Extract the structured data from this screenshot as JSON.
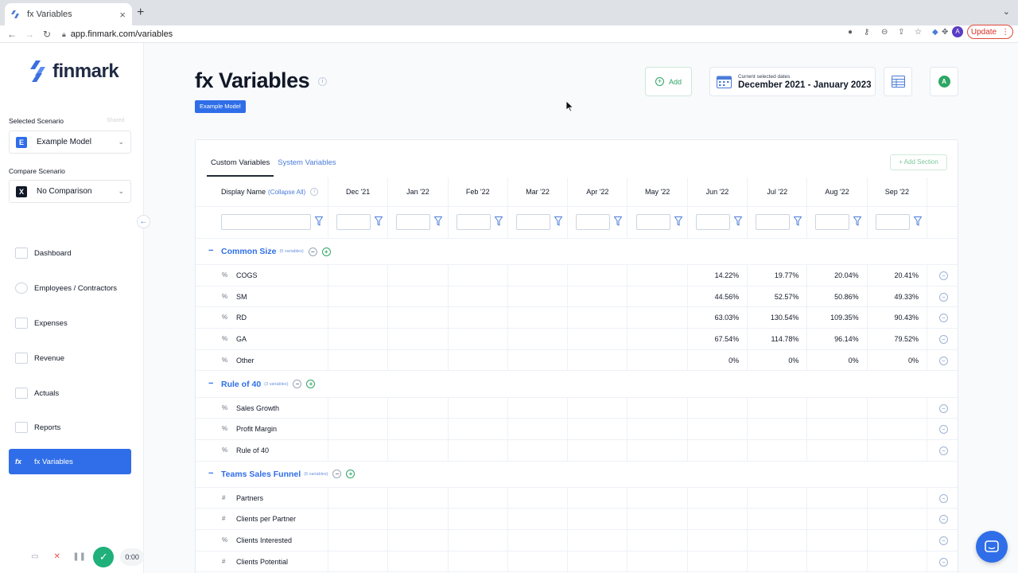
{
  "browser": {
    "tab_title": "fx Variables",
    "url": "app.finmark.com/variables",
    "new_tab": "+",
    "update_label": "Update",
    "profile_initial": "A"
  },
  "sidebar": {
    "brand": "finmark",
    "selected_scenario_label": "Selected Scenario",
    "shared_label": "Shared",
    "selected_scenario": {
      "chip": "E",
      "name": "Example Model"
    },
    "compare_scenario_label": "Compare Scenario",
    "compare_scenario": {
      "chip": "X",
      "name": "No Comparison"
    },
    "nav": [
      {
        "label": "Dashboard"
      },
      {
        "label": "Employees / Contractors"
      },
      {
        "label": "Expenses"
      },
      {
        "label": "Revenue"
      },
      {
        "label": "Actuals"
      },
      {
        "label": "Reports"
      },
      {
        "label": "fx Variables",
        "icon_text": "fx"
      }
    ],
    "recorder_time": "0:00"
  },
  "header": {
    "title": "fx Variables",
    "model_badge": "Example Model",
    "add_label": "Add",
    "dates_caption": "Current selected dates",
    "dates_value": "December 2021 - January 2023",
    "user_initial": "A"
  },
  "table": {
    "tabs": [
      "Custom Variables",
      "System Variables"
    ],
    "add_section_label": "+ Add Section",
    "name_header": "Display Name",
    "collapse_all": "(Collapse All)",
    "months": [
      "Dec '21",
      "Jan '22",
      "Feb '22",
      "Mar '22",
      "Apr '22",
      "May '22",
      "Jun '22",
      "Jul '22",
      "Aug '22",
      "Sep '22"
    ],
    "sections": [
      {
        "name": "Common Size",
        "count": "(5 variables)",
        "rows": [
          {
            "sym": "%",
            "name": "COGS",
            "values": [
              "",
              "",
              "",
              "",
              "",
              "",
              "14.22%",
              "19.77%",
              "20.04%",
              "20.41%"
            ]
          },
          {
            "sym": "%",
            "name": "SM",
            "values": [
              "",
              "",
              "",
              "",
              "",
              "",
              "44.56%",
              "52.57%",
              "50.86%",
              "49.33%"
            ]
          },
          {
            "sym": "%",
            "name": "RD",
            "values": [
              "",
              "",
              "",
              "",
              "",
              "",
              "63.03%",
              "130.54%",
              "109.35%",
              "90.43%"
            ]
          },
          {
            "sym": "%",
            "name": "GA",
            "values": [
              "",
              "",
              "",
              "",
              "",
              "",
              "67.54%",
              "114.78%",
              "96.14%",
              "79.52%"
            ]
          },
          {
            "sym": "%",
            "name": "Other",
            "values": [
              "",
              "",
              "",
              "",
              "",
              "",
              "0%",
              "0%",
              "0%",
              "0%"
            ]
          }
        ]
      },
      {
        "name": "Rule of 40",
        "count": "(3 variables)",
        "rows": [
          {
            "sym": "%",
            "name": "Sales Growth",
            "values": [
              "",
              "",
              "",
              "",
              "",
              "",
              "",
              "",
              "",
              ""
            ]
          },
          {
            "sym": "%",
            "name": "Profit Margin",
            "values": [
              "",
              "",
              "",
              "",
              "",
              "",
              "",
              "",
              "",
              ""
            ]
          },
          {
            "sym": "%",
            "name": "Rule of 40",
            "values": [
              "",
              "",
              "",
              "",
              "",
              "",
              "",
              "",
              "",
              ""
            ]
          }
        ]
      },
      {
        "name": "Teams Sales Funnel",
        "count": "(6 variables)",
        "rows": [
          {
            "sym": "#",
            "name": "Partners",
            "values": [
              "",
              "",
              "",
              "",
              "",
              "",
              "",
              "",
              "",
              ""
            ]
          },
          {
            "sym": "#",
            "name": "Clients per Partner",
            "values": [
              "",
              "",
              "",
              "",
              "",
              "",
              "",
              "",
              "",
              ""
            ]
          },
          {
            "sym": "%",
            "name": "Clients Interested",
            "values": [
              "",
              "",
              "",
              "",
              "",
              "",
              "",
              "",
              "",
              ""
            ]
          },
          {
            "sym": "#",
            "name": "Clients Potential",
            "values": [
              "",
              "",
              "",
              "",
              "",
              "",
              "",
              "",
              "",
              ""
            ]
          }
        ]
      }
    ]
  },
  "colors": {
    "accent": "#2f6ee8",
    "green": "#2ea664",
    "nav_active": "#2f6ee8"
  }
}
